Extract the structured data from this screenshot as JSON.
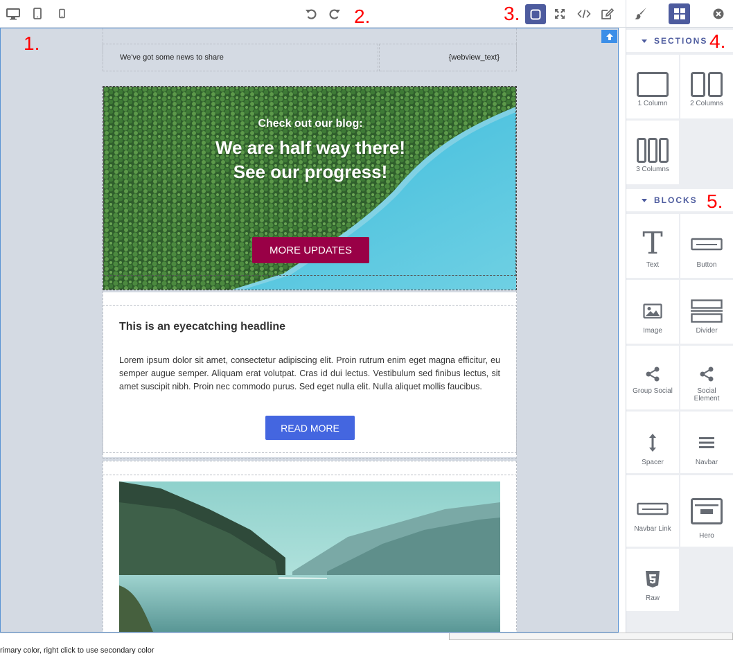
{
  "toolbar": {
    "devices": [
      "desktop-icon",
      "tablet-icon",
      "mobile-icon"
    ],
    "history": [
      "undo-icon",
      "redo-icon"
    ],
    "options": [
      "sw-visibility-icon",
      "fullscreen-icon",
      "code-icon",
      "edit-icon"
    ]
  },
  "panel_tabs": [
    "style-manager-icon",
    "blocks-icon",
    "close-icon"
  ],
  "markers": [
    "1.",
    "2.",
    "3.",
    "4.",
    "5."
  ],
  "sections": {
    "title": "SECTIONS",
    "items": [
      {
        "label": "1 Column",
        "icon": "one-column-icon"
      },
      {
        "label": "2 Columns",
        "icon": "two-columns-icon"
      },
      {
        "label": "3 Columns",
        "icon": "three-columns-icon"
      }
    ]
  },
  "blocks": {
    "title": "BLOCKS",
    "items": [
      {
        "label": "Text",
        "icon": "text-icon"
      },
      {
        "label": "Button",
        "icon": "button-icon"
      },
      {
        "label": "Image",
        "icon": "image-icon"
      },
      {
        "label": "Divider",
        "icon": "divider-icon"
      },
      {
        "label": "Group Social",
        "icon": "share-icon"
      },
      {
        "label": "Social Element",
        "icon": "share-icon"
      },
      {
        "label": "Spacer",
        "icon": "spacer-icon"
      },
      {
        "label": "Navbar",
        "icon": "menu-icon"
      },
      {
        "label": "Navbar Link",
        "icon": "navbar-link-icon"
      },
      {
        "label": "Hero",
        "icon": "hero-icon"
      },
      {
        "label": "Raw",
        "icon": "html5-icon"
      }
    ]
  },
  "email": {
    "preheader_left": "We've got some news to share",
    "preheader_right": "{webview_text}",
    "hero_sub": "Check out our blog:",
    "hero_title_1": "We are half way there!",
    "hero_title_2": "See our progress!",
    "hero_button": "MORE UPDATES",
    "headline": "This is an eyecatching headline",
    "paragraph": "Lorem ipsum dolor sit amet, consectetur adipiscing elit. Proin rutrum enim eget magna efficitur, eu semper augue semper. Aliquam erat volutpat. Cras id dui lectus. Vestibulum sed finibus lectus, sit amet suscipit nibh. Proin nec commodo purus. Sed eget nulla elit. Nulla aliquet mollis faucibus.",
    "read_more": "READ MORE"
  },
  "status": "rimary color, right click to use secondary color",
  "colors": {
    "accent": "#4d5b9e",
    "hero_button": "#990046",
    "read_more": "#4466e0",
    "canvas_bg": "#d4dae3",
    "marker": "#ff0000"
  }
}
